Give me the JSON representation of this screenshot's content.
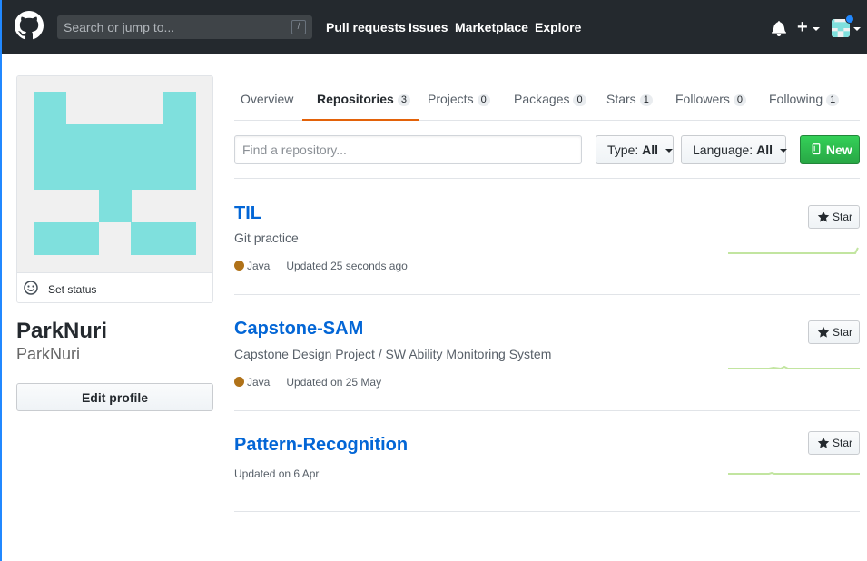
{
  "header": {
    "search_placeholder": "Search or jump to...",
    "search_key": "/",
    "nav": [
      {
        "label": "Pull requests"
      },
      {
        "label": "Issues"
      },
      {
        "label": "Marketplace"
      },
      {
        "label": "Explore"
      }
    ],
    "icons": [
      "github-logo-icon",
      "bell-icon",
      "plus-icon",
      "avatar"
    ]
  },
  "sidebar": {
    "set_status": "Set status",
    "fullname": "ParkNuri",
    "username": "ParkNuri",
    "edit_profile": "Edit profile",
    "avatar_color": "#7fe0dd"
  },
  "tabs": [
    {
      "label": "Overview",
      "count": null
    },
    {
      "label": "Repositories",
      "count": "3",
      "selected": true
    },
    {
      "label": "Projects",
      "count": "0"
    },
    {
      "label": "Packages",
      "count": "0"
    },
    {
      "label": "Stars",
      "count": "1"
    },
    {
      "label": "Followers",
      "count": "0"
    },
    {
      "label": "Following",
      "count": "1"
    }
  ],
  "filters": {
    "search_placeholder": "Find a repository...",
    "type_label": "Type:",
    "type_value": "All",
    "language_label": "Language:",
    "language_value": "All",
    "new_label": "New"
  },
  "repos": [
    {
      "name": "TIL",
      "description": "Git practice",
      "language": "Java",
      "updated": "Updated 25 seconds ago",
      "star": "Star"
    },
    {
      "name": "Capstone-SAM",
      "description": "Capstone Design Project / SW Ability Monitoring System",
      "language": "Java",
      "updated": "Updated on 25 May",
      "star": "Star"
    },
    {
      "name": "Pattern-Recognition",
      "description": "",
      "language": "",
      "updated": "Updated on 6 Apr",
      "star": "Star"
    }
  ],
  "colors": {
    "header_bg": "#24292e",
    "link": "#0366d6",
    "new_button": "#28a745",
    "tab_underline": "#e36209",
    "java": "#b07219",
    "sparkline": "#c2e5a0"
  }
}
